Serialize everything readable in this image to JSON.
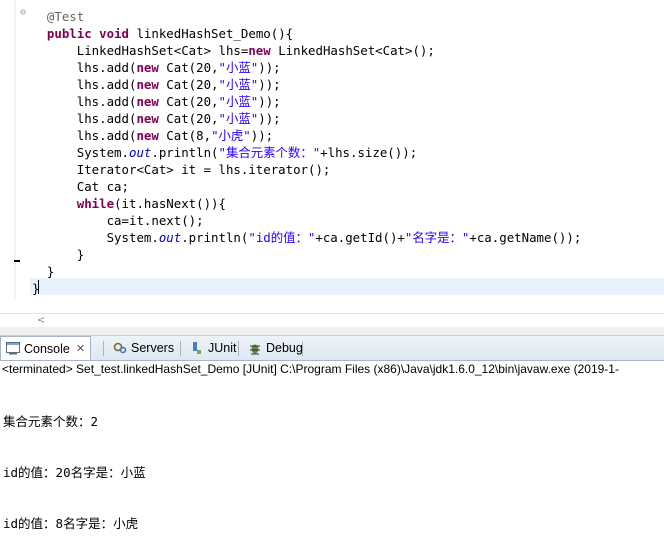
{
  "editor": {
    "lines": [
      [
        {
          "t": "@Test",
          "c": "ann"
        }
      ],
      [
        {
          "t": "public",
          "c": "kw"
        },
        {
          "t": " "
        },
        {
          "t": "void",
          "c": "kw"
        },
        {
          "t": " linkedHashSet_Demo(){"
        }
      ],
      [
        {
          "t": "    LinkedHashSet<Cat> lhs="
        },
        {
          "t": "new",
          "c": "kw"
        },
        {
          "t": " LinkedHashSet<Cat>();"
        }
      ],
      [
        {
          "t": "    lhs.add("
        },
        {
          "t": "new",
          "c": "kw"
        },
        {
          "t": " Cat(20,"
        },
        {
          "t": "\"小蓝\"",
          "c": "str"
        },
        {
          "t": "));"
        }
      ],
      [
        {
          "t": "    lhs.add("
        },
        {
          "t": "new",
          "c": "kw"
        },
        {
          "t": " Cat(20,"
        },
        {
          "t": "\"小蓝\"",
          "c": "str"
        },
        {
          "t": "));"
        }
      ],
      [
        {
          "t": "    lhs.add("
        },
        {
          "t": "new",
          "c": "kw"
        },
        {
          "t": " Cat(20,"
        },
        {
          "t": "\"小蓝\"",
          "c": "str"
        },
        {
          "t": "));"
        }
      ],
      [
        {
          "t": "    lhs.add("
        },
        {
          "t": "new",
          "c": "kw"
        },
        {
          "t": " Cat(20,"
        },
        {
          "t": "\"小蓝\"",
          "c": "str"
        },
        {
          "t": "));"
        }
      ],
      [
        {
          "t": "    lhs.add("
        },
        {
          "t": "new",
          "c": "kw"
        },
        {
          "t": " Cat(8,"
        },
        {
          "t": "\"小虎\"",
          "c": "str"
        },
        {
          "t": "));"
        }
      ],
      [
        {
          "t": "    System."
        },
        {
          "t": "out",
          "c": "fld"
        },
        {
          "t": ".println("
        },
        {
          "t": "\"集合元素个数：\"",
          "c": "str"
        },
        {
          "t": "+lhs.size());"
        }
      ],
      [
        {
          "t": "    Iterator<Cat> it = lhs.iterator();"
        }
      ],
      [
        {
          "t": "    Cat ca;"
        }
      ],
      [
        {
          "t": "    "
        },
        {
          "t": "while",
          "c": "kw"
        },
        {
          "t": "(it.hasNext()){"
        }
      ],
      [
        {
          "t": "        ca=it.next();"
        }
      ],
      [
        {
          "t": "        System."
        },
        {
          "t": "out",
          "c": "fld"
        },
        {
          "t": ".println("
        },
        {
          "t": "\"id的值：\"",
          "c": "str"
        },
        {
          "t": "+ca.getId()+"
        },
        {
          "t": "\"名字是：\"",
          "c": "str"
        },
        {
          "t": "+ca.getName());"
        }
      ],
      [
        {
          "t": "    }"
        }
      ],
      [
        {
          "t": "  }"
        }
      ],
      [
        {
          "t": "}"
        }
      ]
    ],
    "fold_marker": "⊖"
  },
  "tabs": [
    {
      "label": "Console",
      "icon": "console-icon",
      "active": true,
      "close": "✕"
    },
    {
      "label": "Servers",
      "icon": "servers-icon",
      "active": false
    },
    {
      "label": "JUnit",
      "icon": "junit-icon",
      "active": false
    },
    {
      "label": "Debug",
      "icon": "debug-icon",
      "active": false
    }
  ],
  "status": "<terminated> Set_test.linkedHashSet_Demo [JUnit] C:\\Program Files (x86)\\Java\\jdk1.6.0_12\\bin\\javaw.exe (2019-1-",
  "console_lines": [
    "集合元素个数：2",
    "id的值：20名字是：小蓝",
    "id的值：8名字是：小虎"
  ],
  "colors": {
    "keyword": "#7f0055",
    "string": "#2a00ff",
    "annotation": "#646464",
    "field": "#0000c0",
    "current_line": "#e8f2fe"
  }
}
